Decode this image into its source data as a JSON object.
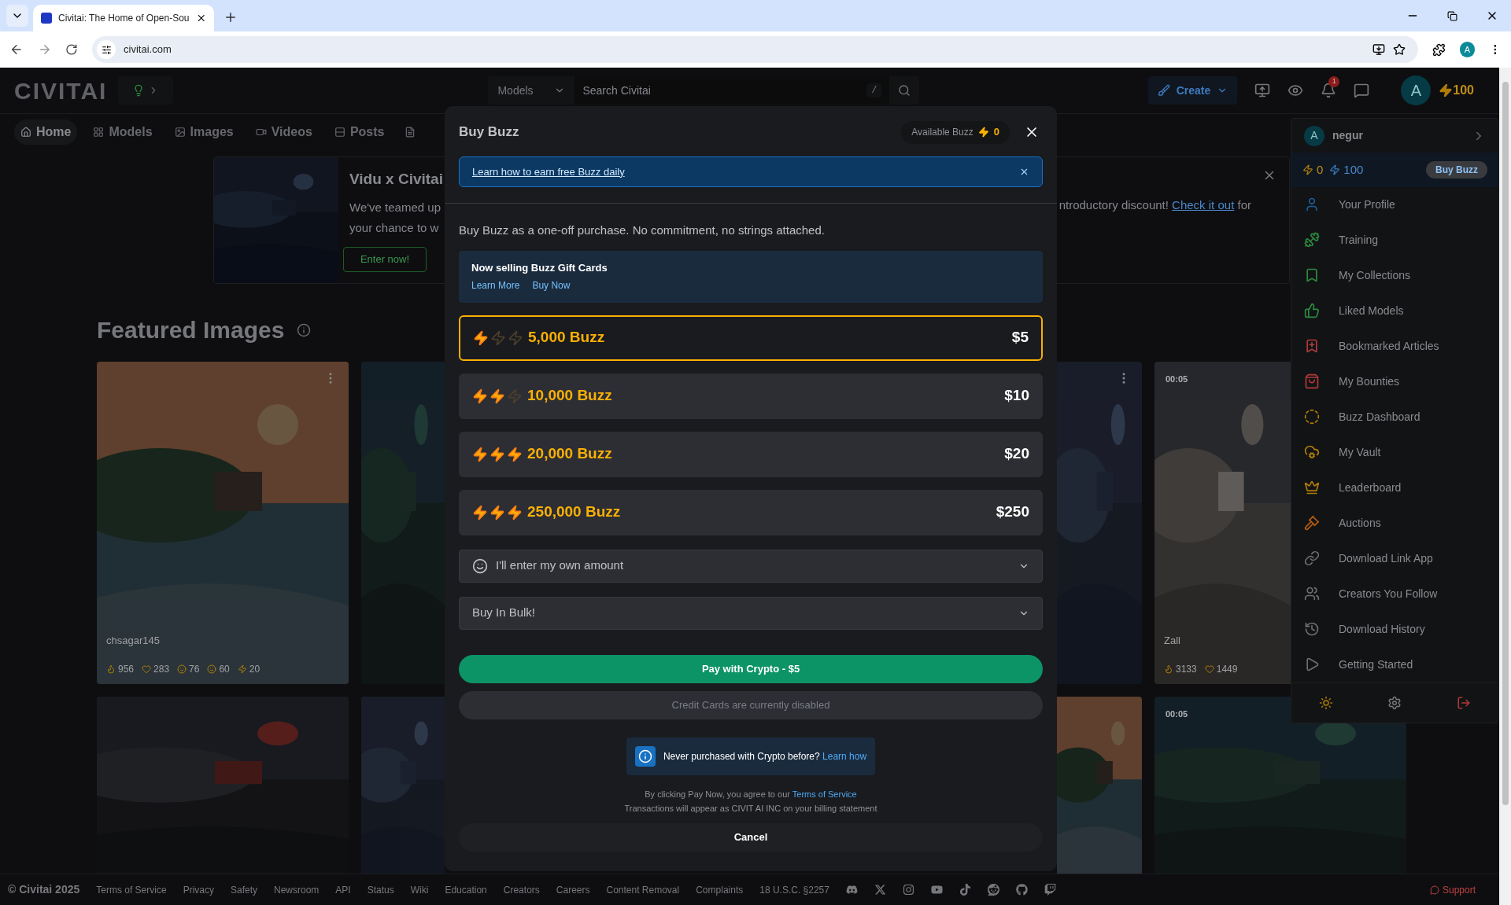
{
  "browser": {
    "tab_title": "Civitai: The Home of Open-Sou",
    "url": "civitai.com",
    "profile": "A"
  },
  "header": {
    "logo": "CIVITAI",
    "search_scope": "Models",
    "search_placeholder": "Search Civitai",
    "shortcut": "/",
    "create": "Create",
    "notifications": "1",
    "avatar": "A",
    "buzz": "100"
  },
  "nav": [
    {
      "label": "Home",
      "selected": true
    },
    {
      "label": "Models",
      "selected": false
    },
    {
      "label": "Images",
      "selected": false
    },
    {
      "label": "Videos",
      "selected": false
    },
    {
      "label": "Posts",
      "selected": false
    }
  ],
  "banner": {
    "title": "Vidu x Civitai",
    "line_1": "We've teamed up",
    "line_2": "your chance to w",
    "right_text": "ntroductory discount!",
    "right_link": "Check it out",
    "right_tail": "for",
    "button": "Enter now!"
  },
  "featured": {
    "title": "Featured Images",
    "cards": [
      {
        "user": "chsagar145",
        "stats": [
          "956",
          "283",
          "76",
          "60",
          "20"
        ]
      },
      {
        "duration": "00:05",
        "user": "Zall",
        "stats": [
          "3133",
          "1449"
        ]
      }
    ],
    "row2_duration": "00:05"
  },
  "menu": {
    "user": "negur",
    "avatar": "A",
    "buzz_yellow": "0",
    "buzz_blue": "100",
    "buy": "Buy Buzz",
    "items": [
      {
        "label": "Your Profile",
        "color": "#1c5f9e"
      },
      {
        "label": "Training",
        "color": "#2c8a3f"
      },
      {
        "label": "My Collections",
        "color": "#2c8a3f"
      },
      {
        "label": "Liked Models",
        "color": "#2c8a3f"
      },
      {
        "label": "Bookmarked Articles",
        "color": "#b03a3a"
      },
      {
        "label": "My Bounties",
        "color": "#b03a3a"
      },
      {
        "label": "Buzz Dashboard",
        "color": "#b07d08"
      },
      {
        "label": "My Vault",
        "color": "#b07d08"
      },
      {
        "label": "Leaderboard",
        "color": "#b07d08"
      },
      {
        "label": "Auctions",
        "color": "#b35a0e"
      },
      {
        "label": "Download Link App",
        "color": "#6e6f73"
      },
      {
        "label": "Creators You Follow",
        "color": "#6e6f73"
      },
      {
        "label": "Download History",
        "color": "#6e6f73"
      },
      {
        "label": "Getting Started",
        "color": "#6e6f73"
      }
    ]
  },
  "modal": {
    "title": "Buy Buzz",
    "available_label": "Available Buzz",
    "available": "0",
    "alert": "Learn how to earn free Buzz daily",
    "description": "Buy Buzz as a one-off purchase. No commitment, no strings attached.",
    "gift": {
      "title": "Now selling Buzz Gift Cards",
      "links": [
        "Learn More",
        "Buy Now"
      ]
    },
    "options": [
      {
        "amount": "5,000 Buzz",
        "price": "$5",
        "stars": 1,
        "selected": true
      },
      {
        "amount": "10,000 Buzz",
        "price": "$10",
        "stars": 2,
        "selected": false
      },
      {
        "amount": "20,000 Buzz",
        "price": "$20",
        "stars": 3,
        "selected": false
      },
      {
        "amount": "250,000 Buzz",
        "price": "$250",
        "stars": 3,
        "selected": false
      }
    ],
    "own_amount": "I'll enter my own amount",
    "bulk": "Buy In Bulk!",
    "pay": {
      "label": "Pay with Crypto - $5",
      "disabled": false
    },
    "card": {
      "label": "Credit Cards are currently disabled",
      "disabled": true
    },
    "info": {
      "text": "Never purchased with Crypto before?",
      "link": "Learn how"
    },
    "terms": {
      "text": "By clicking Pay Now, you agree to our",
      "link": "Terms of Service",
      "line_2": "Transactions will appear as CIVIT AI INC on your billing statement"
    },
    "cancel": "Cancel"
  },
  "footer": {
    "copyright": "© Civitai 2025",
    "links": [
      "Terms of Service",
      "Privacy",
      "Safety",
      "Newsroom",
      "API",
      "Status",
      "Wiki",
      "Education",
      "Creators",
      "Careers",
      "Content Removal",
      "Complaints",
      "18 U.S.C. §2257"
    ],
    "support": "Support"
  }
}
